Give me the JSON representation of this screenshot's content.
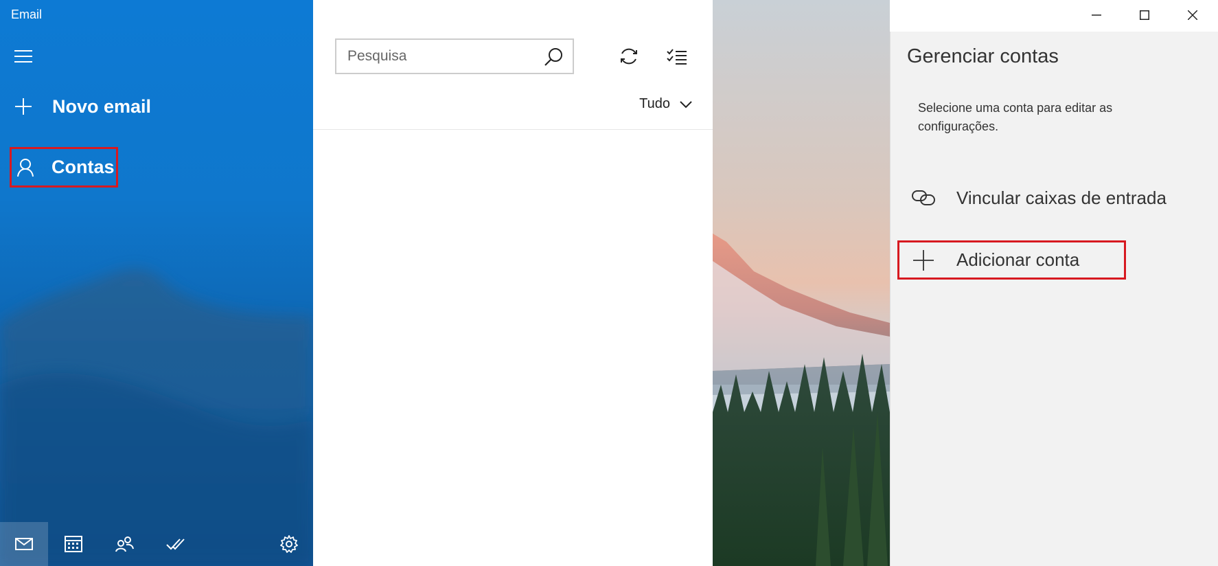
{
  "app": {
    "title": "Email"
  },
  "colors": {
    "accent": "#0f77cc",
    "highlight": "#d71920",
    "flyout_bg": "#f2f2f2"
  },
  "nav": {
    "menu_icon": "hamburger-icon",
    "new_email": {
      "label": "Novo email",
      "icon": "plus-icon"
    },
    "accounts": {
      "label": "Contas",
      "icon": "person-icon"
    }
  },
  "bottom_bar": [
    {
      "name": "mail",
      "icon": "mail-icon",
      "active": true
    },
    {
      "name": "calendar",
      "icon": "calendar-icon",
      "active": false
    },
    {
      "name": "people",
      "icon": "people-icon",
      "active": false
    },
    {
      "name": "todo",
      "icon": "double-check-icon",
      "active": false
    },
    {
      "name": "settings",
      "icon": "gear-icon",
      "active": false
    }
  ],
  "search": {
    "placeholder": "Pesquisa",
    "value": ""
  },
  "toolbar": {
    "sync_icon": "sync-icon",
    "select_icon": "select-mode-icon"
  },
  "filter": {
    "label": "Tudo"
  },
  "flyout": {
    "title": "Gerenciar contas",
    "description": "Selecione uma conta para editar as configurações.",
    "items": [
      {
        "label": "Vincular caixas de entrada",
        "icon": "link-icon"
      },
      {
        "label": "Adicionar conta",
        "icon": "plus-icon"
      }
    ]
  }
}
